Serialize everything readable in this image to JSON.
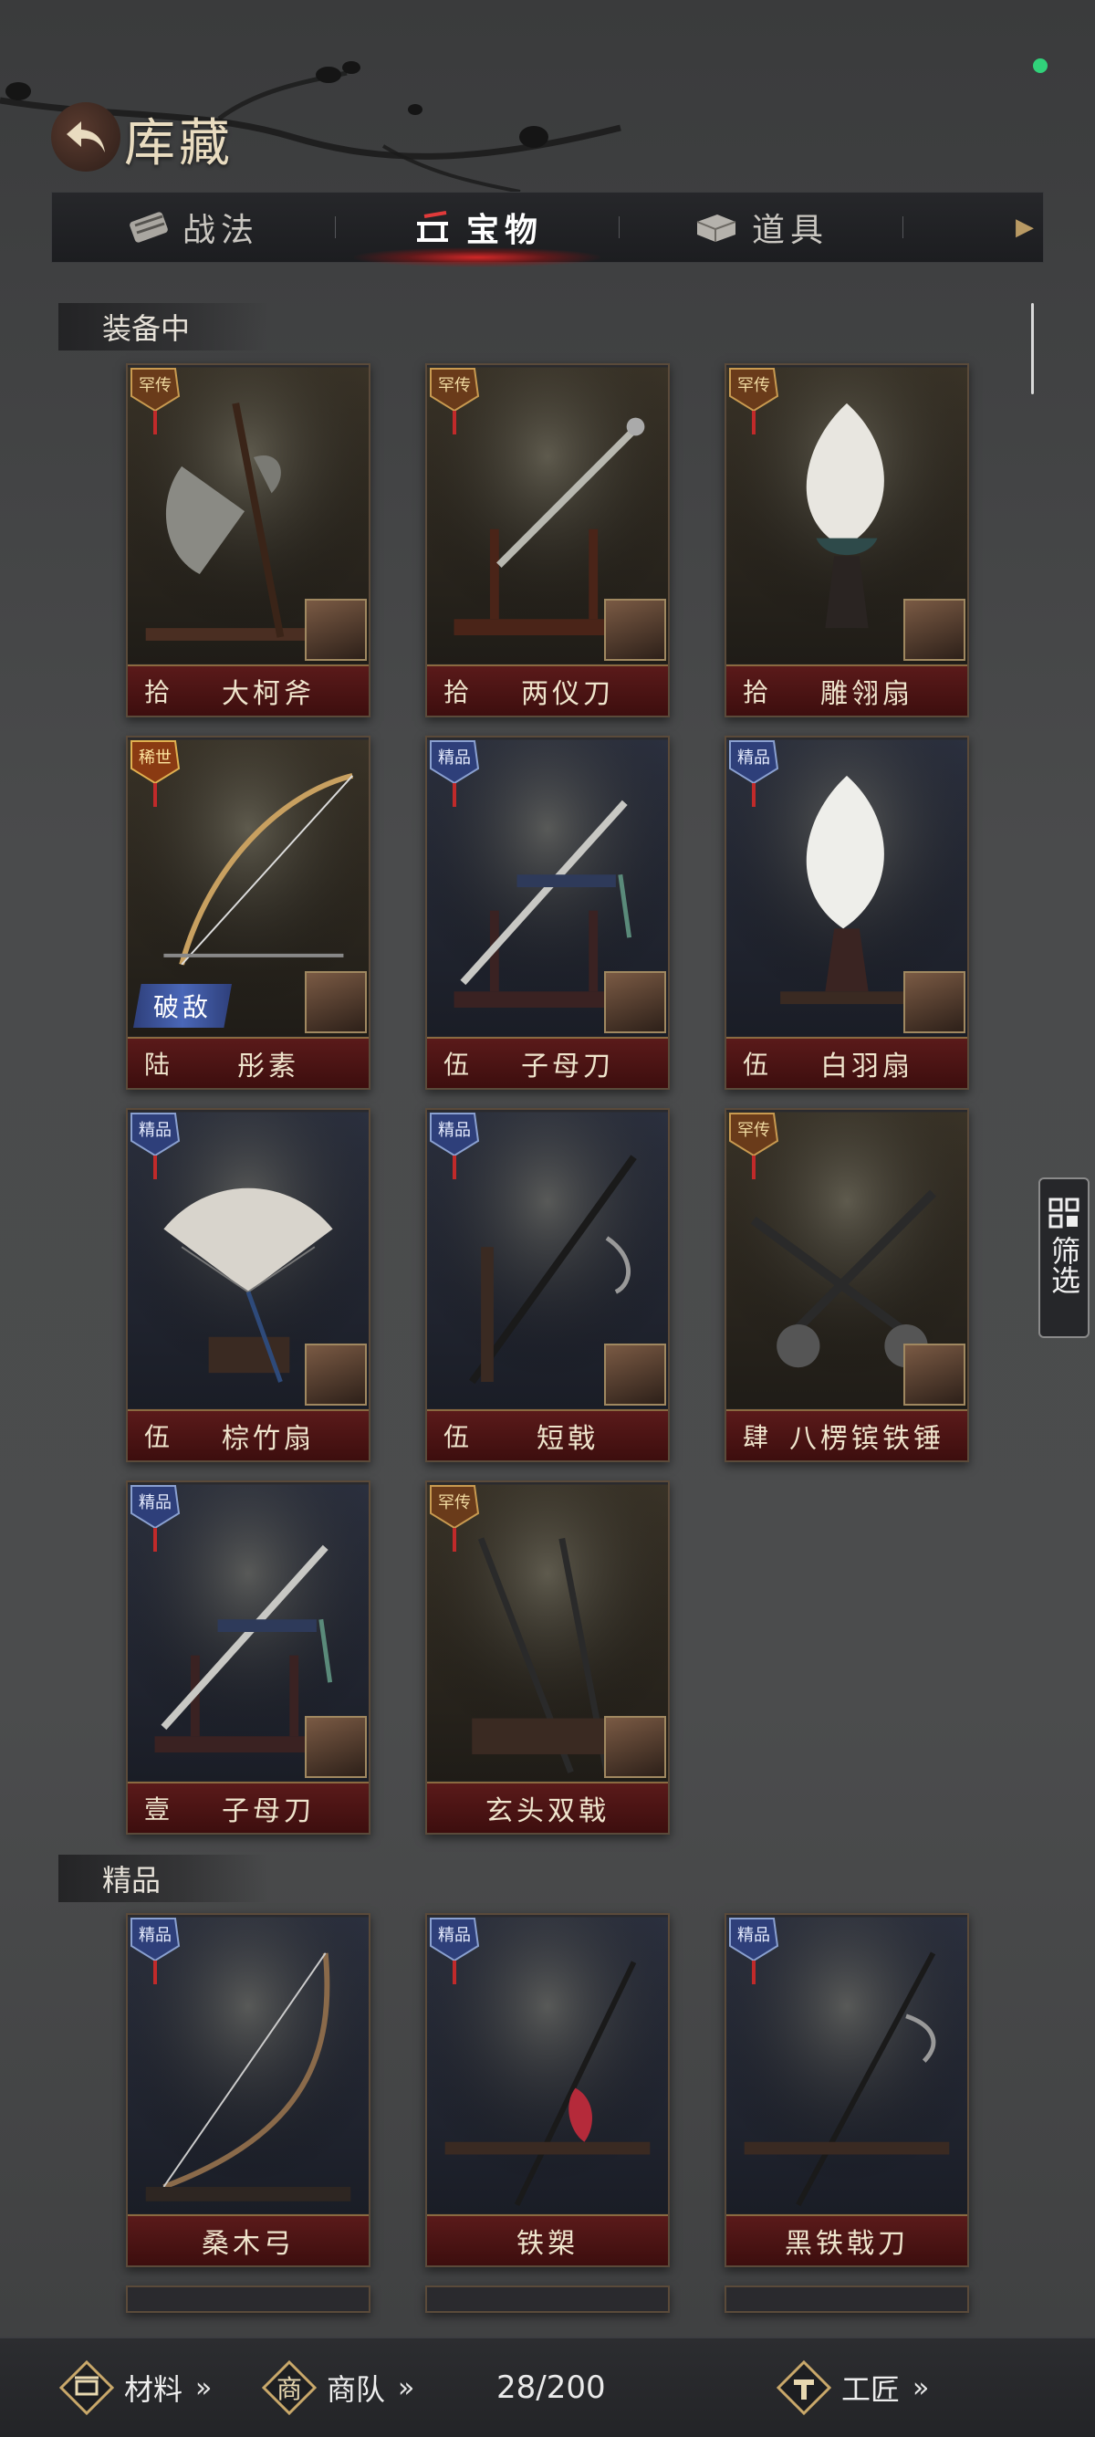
{
  "header": {
    "title": "库藏"
  },
  "tabs": [
    {
      "label": "战法",
      "icon": "scroll-icon",
      "active": false
    },
    {
      "label": "宝物",
      "icon": "weapon-rack-icon",
      "active": true
    },
    {
      "label": "道具",
      "icon": "box-icon",
      "active": false
    }
  ],
  "sections": {
    "equipped": "装备中",
    "fine": "精品"
  },
  "cards": [
    {
      "level": "拾",
      "name": "大柯斧",
      "badge": "罕传",
      "tag": ""
    },
    {
      "level": "拾",
      "name": "两仪刀",
      "badge": "罕传",
      "tag": ""
    },
    {
      "level": "拾",
      "name": "雕翎扇",
      "badge": "罕传",
      "tag": ""
    },
    {
      "level": "陆",
      "name": "彤素",
      "badge": "稀世",
      "tag": "破敌"
    },
    {
      "level": "伍",
      "name": "子母刀",
      "badge": "精品",
      "tag": ""
    },
    {
      "level": "伍",
      "name": "白羽扇",
      "badge": "精品",
      "tag": ""
    },
    {
      "level": "伍",
      "name": "棕竹扇",
      "badge": "精品",
      "tag": ""
    },
    {
      "level": "伍",
      "name": "短戟",
      "badge": "精品",
      "tag": ""
    },
    {
      "level": "肆",
      "name": "八楞镔铁锤",
      "badge": "罕传",
      "tag": ""
    },
    {
      "level": "壹",
      "name": "子母刀",
      "badge": "精品",
      "tag": ""
    },
    {
      "level": "",
      "name": "玄头双戟",
      "badge": "罕传",
      "tag": ""
    },
    {
      "level": "",
      "name": "桑木弓",
      "badge": "精品",
      "tag": ""
    },
    {
      "level": "",
      "name": "铁槊",
      "badge": "精品",
      "tag": ""
    },
    {
      "level": "",
      "name": "黑铁戟刀",
      "badge": "精品",
      "tag": ""
    }
  ],
  "filter": {
    "label": "筛选"
  },
  "bottombar": {
    "materials": "材料",
    "caravan": "商队",
    "count": "28/200",
    "craftsman": "工匠"
  },
  "colors": {
    "accent_red": "#d42a2a",
    "gold": "#b99a64",
    "status_green": "#31d27a"
  }
}
